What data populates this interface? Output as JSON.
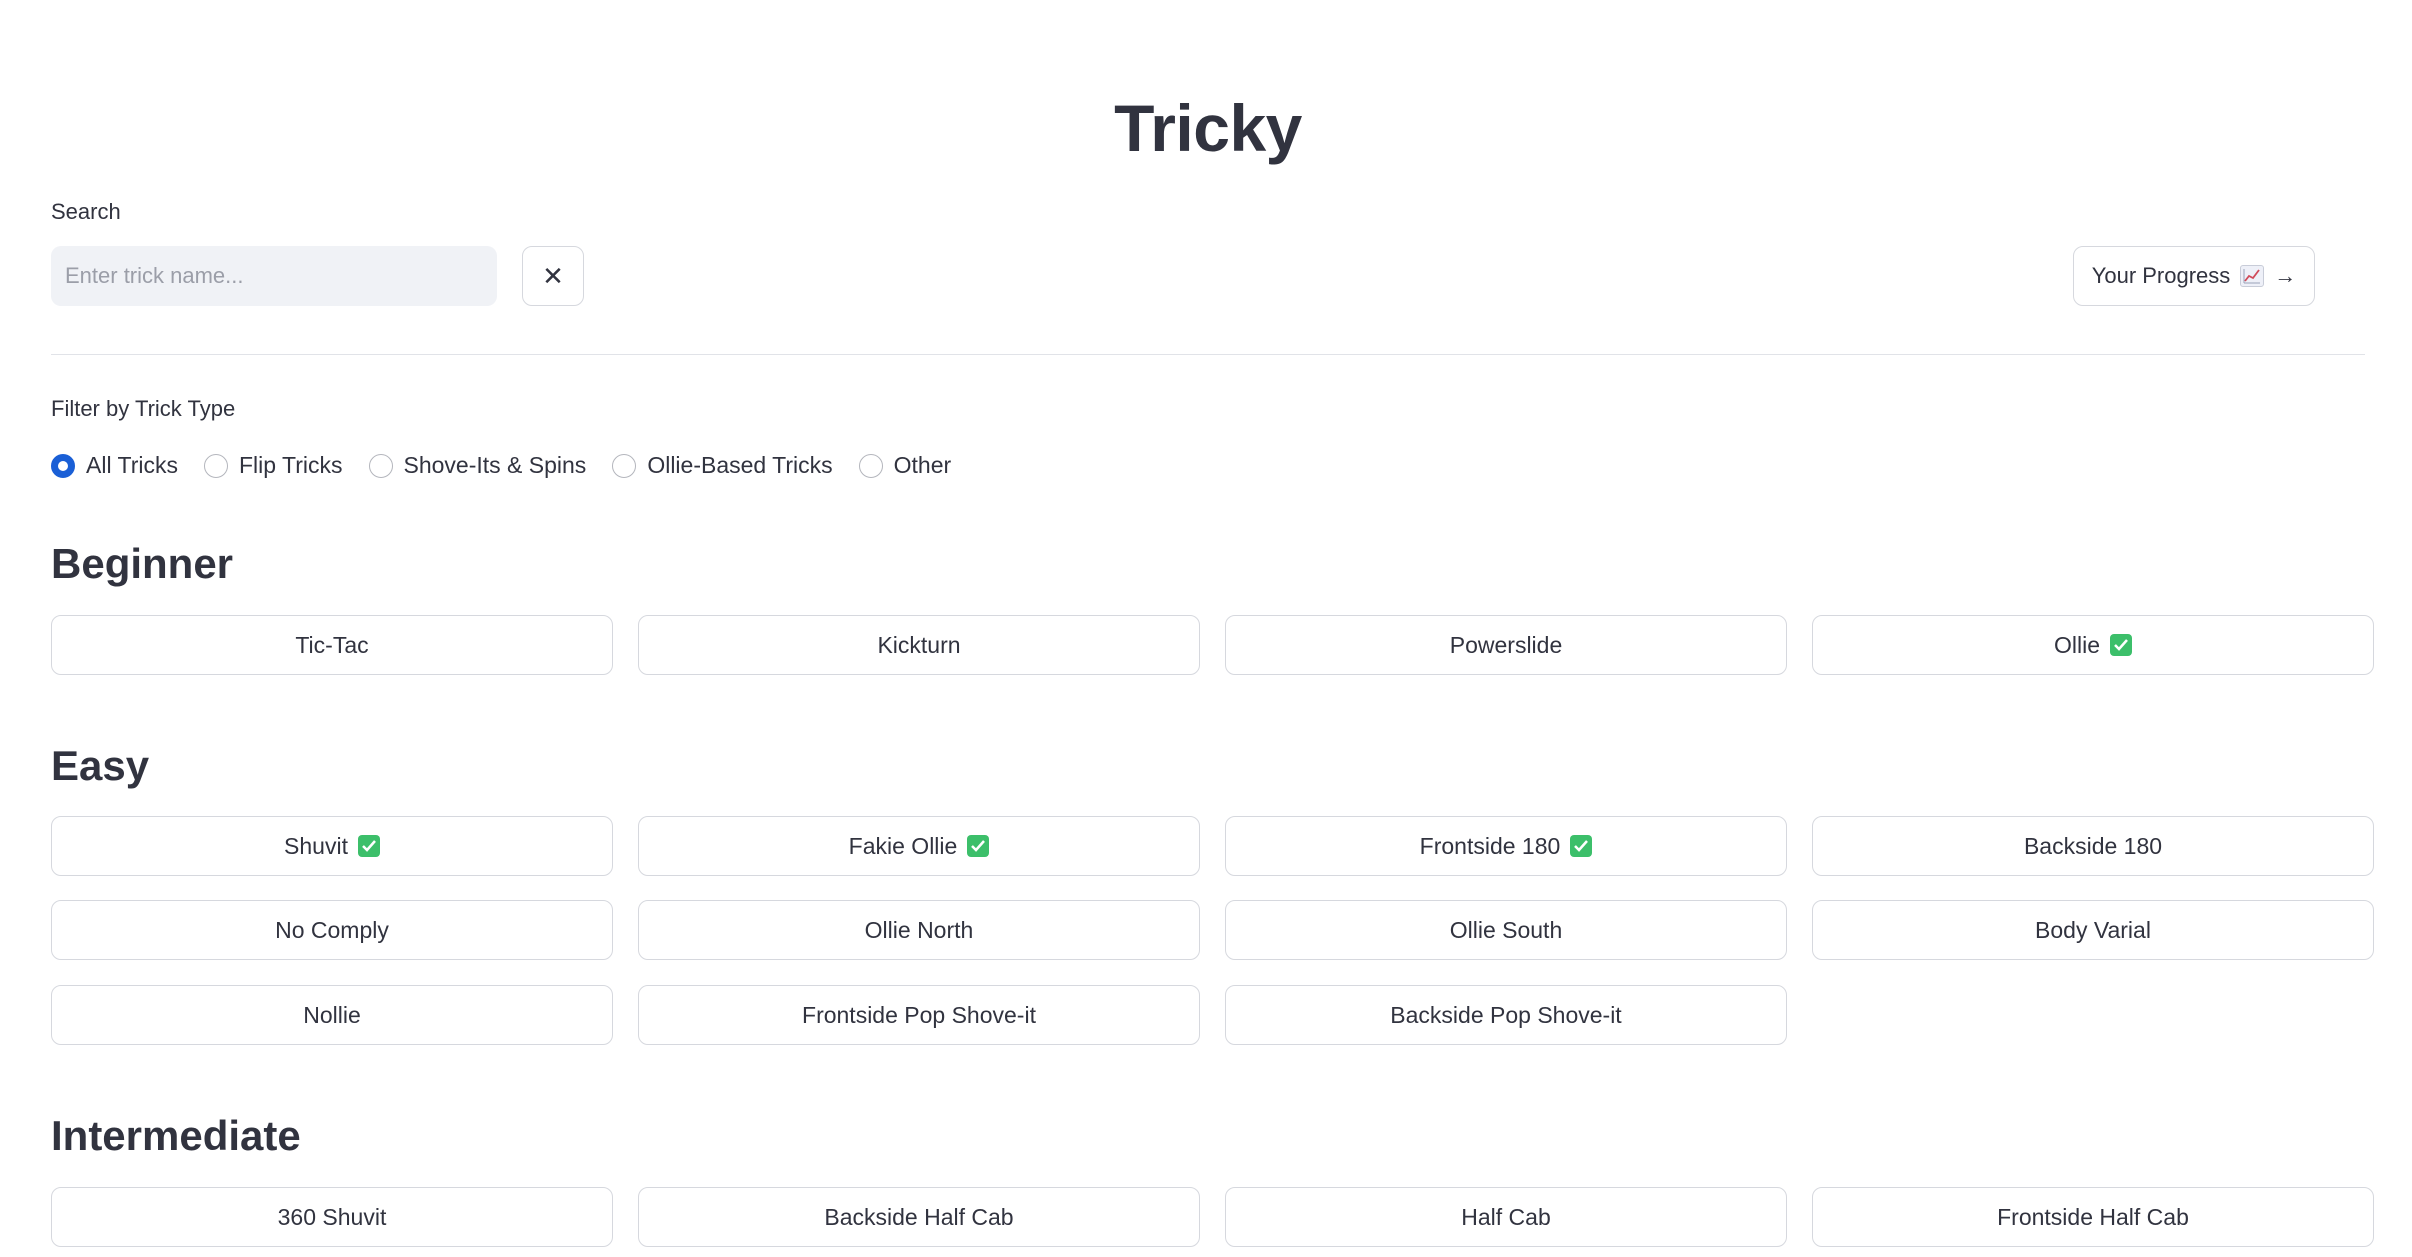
{
  "app": {
    "title": "Tricky"
  },
  "search": {
    "label": "Search",
    "placeholder": "Enter trick name...",
    "value": "",
    "clear_label": "✕"
  },
  "progress_button": {
    "label": "Your Progress",
    "icon": "chart-increasing-icon",
    "arrow": "→"
  },
  "filter": {
    "label": "Filter by Trick Type",
    "selected": "All Tricks",
    "options": [
      "All Tricks",
      "Flip Tricks",
      "Shove-Its & Spins",
      "Ollie-Based Tricks",
      "Other"
    ]
  },
  "sections": [
    {
      "heading": "Beginner",
      "tricks": [
        {
          "name": "Tic-Tac",
          "done": false
        },
        {
          "name": "Kickturn",
          "done": false
        },
        {
          "name": "Powerslide",
          "done": false
        },
        {
          "name": "Ollie",
          "done": true
        }
      ]
    },
    {
      "heading": "Easy",
      "tricks": [
        {
          "name": "Shuvit",
          "done": true
        },
        {
          "name": "Fakie Ollie",
          "done": true
        },
        {
          "name": "Frontside 180",
          "done": true
        },
        {
          "name": "Backside 180",
          "done": false
        },
        {
          "name": "No Comply",
          "done": false
        },
        {
          "name": "Ollie North",
          "done": false
        },
        {
          "name": "Ollie South",
          "done": false
        },
        {
          "name": "Body Varial",
          "done": false
        },
        {
          "name": "Nollie",
          "done": false
        },
        {
          "name": "Frontside Pop Shove-it",
          "done": false
        },
        {
          "name": "Backside Pop Shove-it",
          "done": false
        }
      ]
    },
    {
      "heading": "Intermediate",
      "tricks": [
        {
          "name": "360 Shuvit",
          "done": false
        },
        {
          "name": "Backside Half Cab",
          "done": false
        },
        {
          "name": "Half Cab",
          "done": false
        },
        {
          "name": "Frontside Half Cab",
          "done": false
        }
      ]
    }
  ],
  "colors": {
    "accent": "#1a5fd6",
    "check": "#3cbf6a",
    "text": "#31333f",
    "input_bg": "#f0f2f6",
    "border": "#d6d8de"
  }
}
